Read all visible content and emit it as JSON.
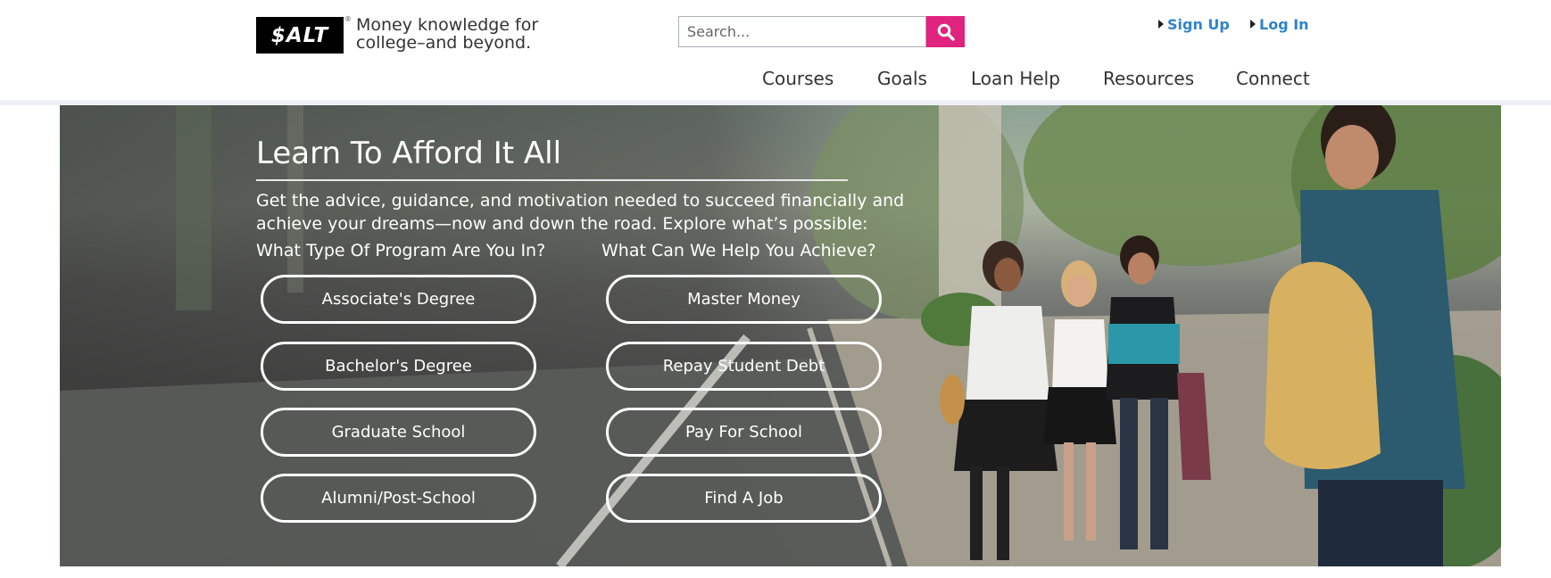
{
  "brand": {
    "logo_text": "$ALT",
    "registered_mark": "®",
    "tagline": "Money knowledge for college–and beyond."
  },
  "search": {
    "placeholder": "Search...",
    "value": ""
  },
  "account": {
    "sign_up": "Sign Up",
    "log_in": "Log In"
  },
  "nav": {
    "items": [
      "Courses",
      "Goals",
      "Loan Help",
      "Resources",
      "Connect"
    ]
  },
  "hero": {
    "title": "Learn To Afford It All",
    "intro": "Get the advice, guidance, and motivation needed to succeed financially and achieve your dreams—now and down the road. Explore what’s possible:",
    "program_heading": "What Type Of Program Are You In?",
    "goal_heading": "What Can We Help You Achieve?",
    "programs": [
      "Associate's Degree",
      "Bachelor's Degree",
      "Graduate School",
      "Alumni/Post-School"
    ],
    "goals": [
      "Master Money",
      "Repay Student Debt",
      "Pay For School",
      "Find A Job"
    ]
  },
  "colors": {
    "accent": "#e0237e",
    "link": "#2f84c9",
    "text": "#333333",
    "divider": "#eef1f6"
  },
  "icons": {
    "search_button": "search-icon",
    "link_marker": "triangle-right-icon"
  }
}
